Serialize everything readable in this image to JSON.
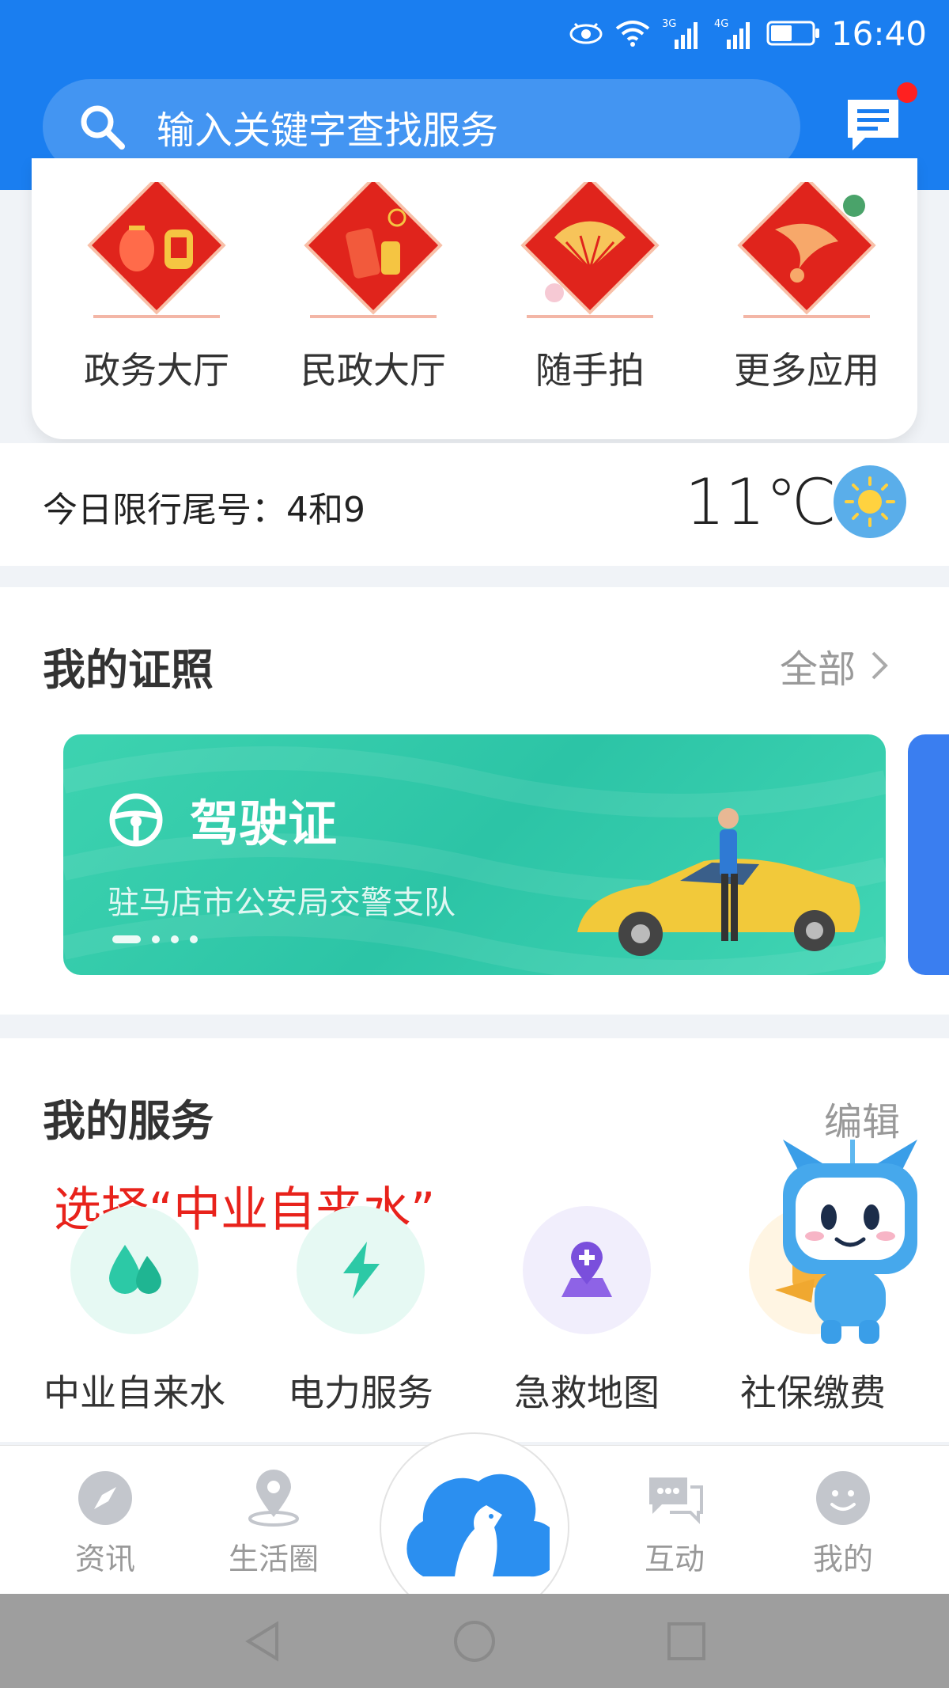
{
  "status_bar": {
    "time": "16:40",
    "net1": "3G",
    "net2": "4G"
  },
  "search": {
    "placeholder": "输入关键字查找服务"
  },
  "apps": [
    {
      "label": "政务大厅",
      "icon": "lantern-badge-icon"
    },
    {
      "label": "民政大厅",
      "icon": "firecracker-badge-icon"
    },
    {
      "label": "随手拍",
      "icon": "fan-badge-icon"
    },
    {
      "label": "更多应用",
      "icon": "fish-badge-icon"
    }
  ],
  "traffic": {
    "limit_text": "今日限行尾号：4和9"
  },
  "weather": {
    "temperature": "11℃",
    "icon": "sun-icon"
  },
  "certificates": {
    "title": "我的证照",
    "more_label": "全部",
    "card": {
      "title": "驾驶证",
      "org": "驻马店市公安局交警支队"
    }
  },
  "services": {
    "title": "我的服务",
    "edit_label": "编辑",
    "annotation": "选择“中业自来水”",
    "items": [
      {
        "label": "中业自来水",
        "icon": "water-drop-icon"
      },
      {
        "label": "电力服务",
        "icon": "lightning-icon"
      },
      {
        "label": "急救地图",
        "icon": "medical-map-icon"
      },
      {
        "label": "社保缴费",
        "icon": "social-security-icon"
      }
    ]
  },
  "bottom_nav": [
    {
      "label": "资讯",
      "icon": "compass-icon"
    },
    {
      "label": "生活圈",
      "icon": "location-pin-icon"
    },
    {
      "label": "",
      "icon": "horse-cloud-logo-icon"
    },
    {
      "label": "互动",
      "icon": "chat-bubbles-icon"
    },
    {
      "label": "我的",
      "icon": "smiley-icon"
    }
  ],
  "colors": {
    "primary": "#1a7ef0",
    "card_green": "#34cdae",
    "annotation_red": "#e8221b",
    "badge_red": "#e0241c"
  }
}
